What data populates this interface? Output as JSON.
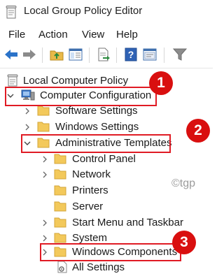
{
  "window": {
    "title": "Local Group Policy Editor"
  },
  "menu": {
    "file": "File",
    "action": "Action",
    "view": "View",
    "help": "Help"
  },
  "toolbar": {
    "buttons": [
      "back-arrow-icon",
      "forward-arrow-icon",
      "up-folder-icon",
      "show-hide-tree-icon",
      "export-list-icon",
      "help-icon",
      "properties-icon",
      "filter-icon"
    ]
  },
  "tree": {
    "root": "Local Computer Policy",
    "computer_configuration": "Computer Configuration",
    "software_settings": "Software Settings",
    "windows_settings": "Windows Settings",
    "administrative_templates": "Administrative Templates",
    "control_panel": "Control Panel",
    "network": "Network",
    "printers": "Printers",
    "server": "Server",
    "start_menu": "Start Menu and Taskbar",
    "system": "System",
    "windows_components": "Windows Components",
    "all_settings": "All Settings"
  },
  "annotations": {
    "step1": "1",
    "step2": "2",
    "step3": "3"
  },
  "watermark": "©tgp",
  "colors": {
    "highlight": "#e01b24",
    "badge": "#d90f0f",
    "folder": "#f3c95b"
  }
}
